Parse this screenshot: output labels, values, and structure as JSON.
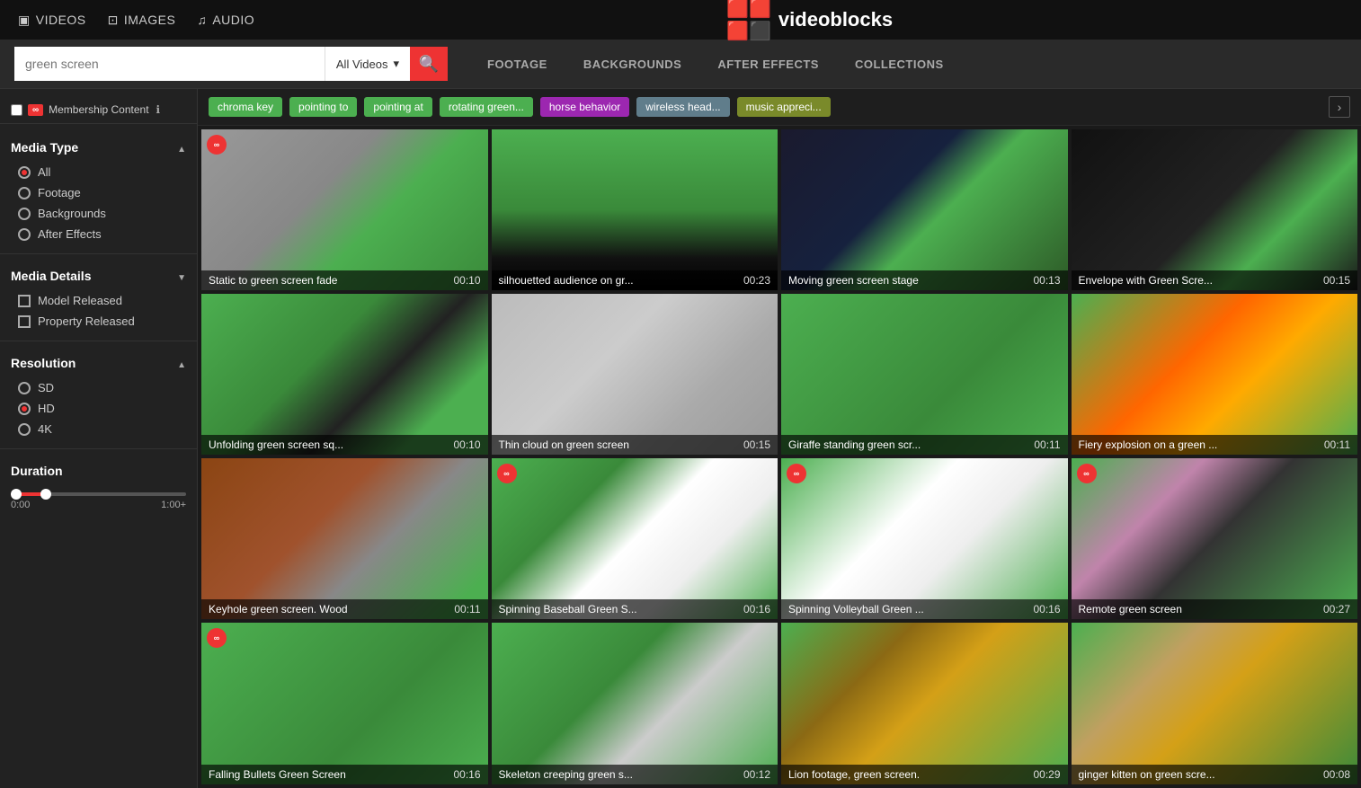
{
  "topNav": {
    "items": [
      {
        "label": "VIDEOS",
        "icon": "video-icon"
      },
      {
        "label": "IMAGES",
        "icon": "images-icon"
      },
      {
        "label": "AUDIO",
        "icon": "audio-icon"
      }
    ],
    "logo": "videoblocks"
  },
  "searchBar": {
    "placeholder": "green screen",
    "dropdownLabel": "All Videos",
    "searchBtnLabel": "🔍",
    "tabs": [
      {
        "label": "FOOTAGE"
      },
      {
        "label": "BACKGROUNDS"
      },
      {
        "label": "AFTER EFFECTS"
      },
      {
        "label": "COLLECTIONS"
      }
    ]
  },
  "sidebar": {
    "membershipLabel": "Membership Content",
    "sections": [
      {
        "title": "Media Type",
        "expanded": true,
        "items": [
          {
            "label": "All",
            "type": "radio",
            "selected": true
          },
          {
            "label": "Footage",
            "type": "radio",
            "selected": false
          },
          {
            "label": "Backgrounds",
            "type": "radio",
            "selected": false
          },
          {
            "label": "After Effects",
            "type": "radio",
            "selected": false
          }
        ]
      },
      {
        "title": "Media Details",
        "expanded": true,
        "items": [
          {
            "label": "Model Released",
            "type": "checkbox",
            "selected": false
          },
          {
            "label": "Property Released",
            "type": "checkbox",
            "selected": false
          }
        ]
      },
      {
        "title": "Resolution",
        "expanded": true,
        "items": [
          {
            "label": "SD",
            "type": "radio",
            "selected": false
          },
          {
            "label": "HD",
            "type": "radio",
            "selected": true
          },
          {
            "label": "4K",
            "type": "radio",
            "selected": false
          }
        ]
      }
    ],
    "duration": {
      "title": "Duration",
      "min": "0:00",
      "max": "1:00+"
    }
  },
  "suggestedTags": [
    {
      "label": "chroma key",
      "color": "green"
    },
    {
      "label": "pointing to",
      "color": "green"
    },
    {
      "label": "pointing at",
      "color": "green"
    },
    {
      "label": "rotating green...",
      "color": "green"
    },
    {
      "label": "horse behavior",
      "color": "purple"
    },
    {
      "label": "wireless head...",
      "color": "gray"
    },
    {
      "label": "music appreci...",
      "color": "olive"
    }
  ],
  "videos": [
    {
      "title": "Static to green screen fade",
      "duration": "00:10",
      "bg": "linear-gradient(135deg, #999 0%, #888 40%, #4CAF50 60%, #3a8a3a 100%)",
      "hasMember": true,
      "memberPos": "top-left"
    },
    {
      "title": "silhouetted audience on gr...",
      "duration": "00:23",
      "bg": "linear-gradient(180deg, #4CAF50 0%, #3a8a3a 50%, #111 80%, #000 100%)",
      "hasMember": false
    },
    {
      "title": "Moving green screen stage",
      "duration": "00:13",
      "bg": "linear-gradient(135deg, #1a1a2e 0%, #16213e 40%, #4CAF50 55%, #2d5a27 100%)",
      "hasMember": false
    },
    {
      "title": "Envelope with Green Scre...",
      "duration": "00:15",
      "bg": "linear-gradient(135deg, #111 0%, #222 50%, #4CAF50 70%, #1a1a1a 100%)",
      "hasMember": false
    },
    {
      "title": "Unfolding green screen sq...",
      "duration": "00:10",
      "bg": "linear-gradient(135deg, #4CAF50 0%, #3a8a3a 40%, #222 60%, #4CAF50 80%)",
      "hasMember": false
    },
    {
      "title": "Thin cloud on green screen",
      "duration": "00:15",
      "bg": "linear-gradient(135deg, #bbb 0%, #ccc 40%, #aaa 70%, #999 100%)",
      "hasMember": false
    },
    {
      "title": "Giraffe standing green scr...",
      "duration": "00:11",
      "bg": "linear-gradient(135deg, #4CAF50 0%, #3a8a3a 60%, #4CAF50 100%)",
      "hasMember": false
    },
    {
      "title": "Fiery explosion on a green ...",
      "duration": "00:11",
      "bg": "linear-gradient(135deg, #4CAF50 0%, #ff6600 40%, #ffaa00 60%, #4CAF50 100%)",
      "hasMember": false
    },
    {
      "title": "Keyhole green screen. Wood",
      "duration": "00:11",
      "bg": "linear-gradient(135deg, #8B4513 0%, #a0522d 40%, #888 60%, #4CAF50 90%)",
      "hasMember": false
    },
    {
      "title": "Spinning Baseball Green S...",
      "duration": "00:16",
      "bg": "linear-gradient(135deg, #4CAF50 0%, #3a8a3a 30%, #fff 50%, #eee 70%, #4CAF50 100%)",
      "hasMember": true
    },
    {
      "title": "Spinning Volleyball Green ...",
      "duration": "00:16",
      "bg": "linear-gradient(135deg, #4CAF50 0%, #fff 40%, #eee 60%, #4CAF50 100%)",
      "hasMember": true
    },
    {
      "title": "Remote green screen",
      "duration": "00:27",
      "bg": "linear-gradient(135deg, #4CAF50 0%, #c084ab 30%, #333 50%, #4CAF50 100%)",
      "hasMember": true
    },
    {
      "title": "Falling Bullets Green Screen",
      "duration": "00:16",
      "bg": "linear-gradient(135deg, #4CAF50 0%, #3a8a3a 60%, #4CAF50 100%)",
      "hasMember": true
    },
    {
      "title": "Skeleton creeping green s...",
      "duration": "00:12",
      "bg": "linear-gradient(135deg, #4CAF50 0%, #3a8a3a 40%, #ccc 60%, #4CAF50 100%)",
      "hasMember": false
    },
    {
      "title": "Lion footage, green screen.",
      "duration": "00:29",
      "bg": "linear-gradient(135deg, #4CAF50 0%, #8B6914 30%, #d4a017 50%, #4CAF50 100%)",
      "hasMember": false
    },
    {
      "title": "ginger kitten on green scre...",
      "duration": "00:08",
      "bg": "linear-gradient(135deg, #4CAF50 0%, #c0a060 30%, #d4a017 50%, #3a8a3a 100%)",
      "hasMember": false
    }
  ]
}
